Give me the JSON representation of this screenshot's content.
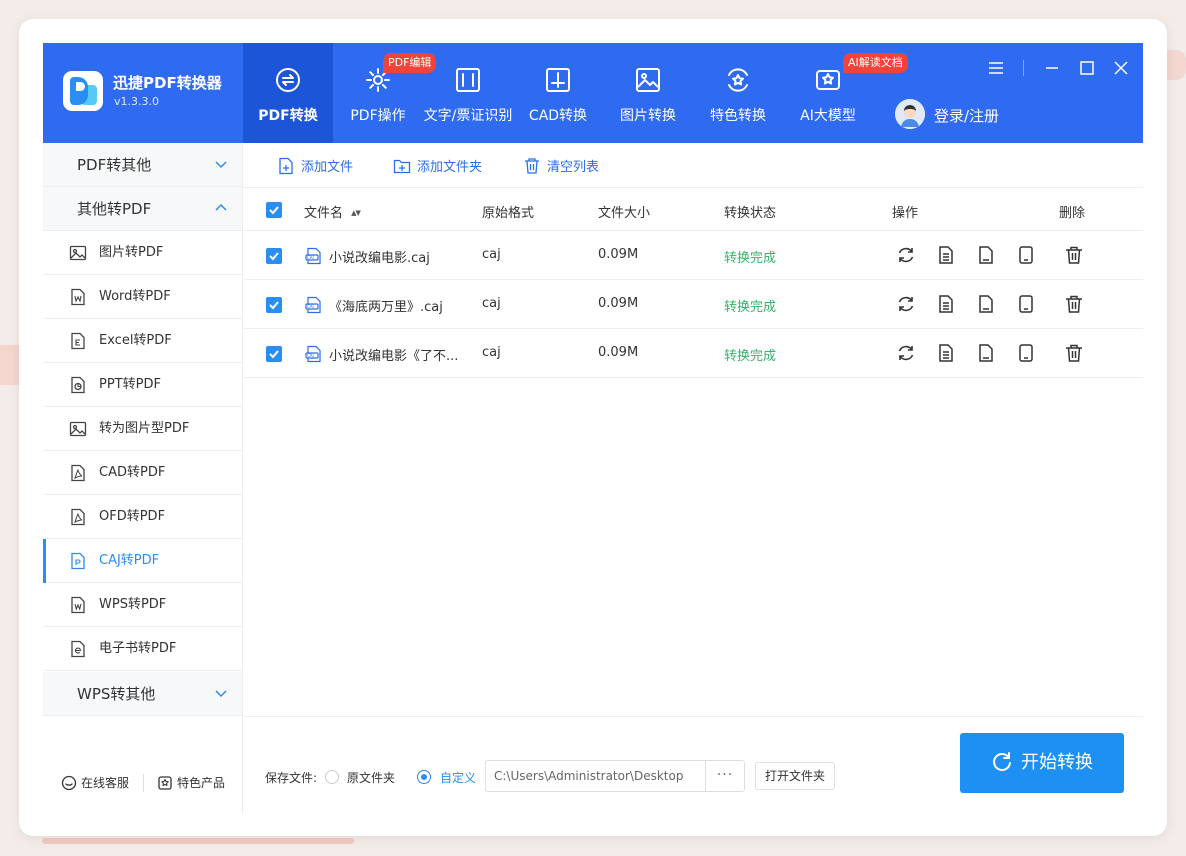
{
  "app": {
    "title": "迅捷PDF转换器",
    "version": "v1.3.3.0"
  },
  "nav": {
    "tabs": [
      {
        "label": "PDF转换",
        "icon": "pdf-convert-icon",
        "active": true
      },
      {
        "label": "PDF操作",
        "icon": "gear-icon",
        "badge": "PDF编辑"
      },
      {
        "label": "文字/票证识别",
        "icon": "scan-icon"
      },
      {
        "label": "CAD转换",
        "icon": "cad-icon"
      },
      {
        "label": "图片转换",
        "icon": "image-icon"
      },
      {
        "label": "特色转换",
        "icon": "star-refresh-icon"
      },
      {
        "label": "AI大模型",
        "icon": "ai-star-icon",
        "badge": "AI解读文档"
      }
    ],
    "login": "登录/注册"
  },
  "sidebar": {
    "categories": [
      {
        "label": "PDF转其他",
        "expanded": false
      },
      {
        "label": "其他转PDF",
        "expanded": true
      },
      {
        "label": "WPS转其他",
        "expanded": false
      }
    ],
    "items": [
      {
        "label": "图片转PDF",
        "icon": "image-icon"
      },
      {
        "label": "Word转PDF",
        "icon": "word-icon"
      },
      {
        "label": "Excel转PDF",
        "icon": "excel-icon"
      },
      {
        "label": "PPT转PDF",
        "icon": "ppt-icon"
      },
      {
        "label": "转为图片型PDF",
        "icon": "image-icon"
      },
      {
        "label": "CAD转PDF",
        "icon": "pdf-file-icon"
      },
      {
        "label": "OFD转PDF",
        "icon": "pdf-file-icon"
      },
      {
        "label": "CAJ转PDF",
        "icon": "caj-icon",
        "active": true
      },
      {
        "label": "WPS转PDF",
        "icon": "wps-icon"
      },
      {
        "label": "电子书转PDF",
        "icon": "ebook-icon"
      }
    ],
    "footer": {
      "service": "在线客服",
      "products": "特色产品"
    }
  },
  "toolbar": {
    "add_file": "添加文件",
    "add_folder": "添加文件夹",
    "clear_list": "清空列表"
  },
  "table": {
    "headers": {
      "name": "文件名",
      "sort_icon": "▲▼",
      "format": "原始格式",
      "size": "文件大小",
      "status": "转换状态",
      "actions": "操作",
      "delete": "删除"
    },
    "rows": [
      {
        "name": "小说改编电影.caj",
        "format": "caj",
        "size": "0.09M",
        "status": "转换完成"
      },
      {
        "name": "《海底两万里》.caj",
        "format": "caj",
        "size": "0.09M",
        "status": "转换完成"
      },
      {
        "name": "小说改编电影《了不...",
        "format": "caj",
        "size": "0.09M",
        "status": "转换完成"
      }
    ]
  },
  "bottom": {
    "save_label": "保存文件:",
    "option_original": "原文件夹",
    "option_custom": "自定义",
    "path": "C:\\Users\\Administrator\\Desktop",
    "dots": "···",
    "open_folder": "打开文件夹",
    "start": "开始转换"
  },
  "colors": {
    "header": "#2f6bf0",
    "header_active": "#1c55d8",
    "accent": "#2a8df2",
    "start_button": "#1f90f3",
    "status_ok": "#34b36b",
    "badge": "#f0433a"
  }
}
